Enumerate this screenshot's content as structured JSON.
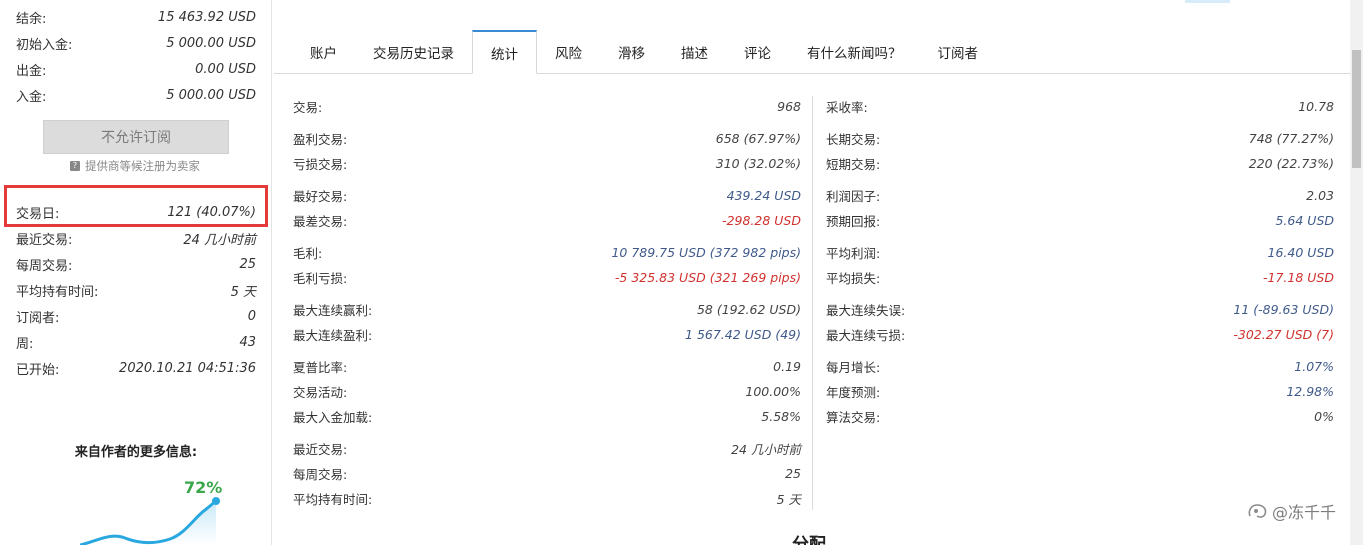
{
  "left": {
    "rows_top": [
      {
        "label": "结余:",
        "value": "15 463.92 USD"
      },
      {
        "label": "初始入金:",
        "value": "5 000.00 USD"
      },
      {
        "label": "出金:",
        "value": "0.00 USD"
      },
      {
        "label": "入金:",
        "value": "5 000.00 USD"
      }
    ],
    "subscribe_button": "不允许订阅",
    "provider_note_icon": "?",
    "provider_note": "提供商等候注册为卖家",
    "rows_bottom": [
      {
        "label": "交易日:",
        "value": "121 (40.07%)"
      },
      {
        "label": "最近交易:",
        "value": "24 几小时前"
      },
      {
        "label": "每周交易:",
        "value": "25"
      },
      {
        "label": "平均持有时间:",
        "value": "5 天"
      },
      {
        "label": "订阅者:",
        "value": "0"
      },
      {
        "label": "周:",
        "value": "43"
      },
      {
        "label": "已开始:",
        "value": "2020.10.21 04:51:36"
      }
    ],
    "more_info_title": "来自作者的更多信息:",
    "growth_percent": "72%"
  },
  "tabs": [
    {
      "label": "账户",
      "active": false
    },
    {
      "label": "交易历史记录",
      "active": false
    },
    {
      "label": "统计",
      "active": true
    },
    {
      "label": "风险",
      "active": false
    },
    {
      "label": "滑移",
      "active": false
    },
    {
      "label": "描述",
      "active": false
    },
    {
      "label": "评论",
      "active": false
    },
    {
      "label": "有什么新闻吗？",
      "active": false
    },
    {
      "label": "订阅者",
      "active": false
    }
  ],
  "stats": {
    "left": [
      {
        "label": "交易:",
        "value": "968",
        "color": "normal"
      },
      {
        "label": "盈利交易:",
        "value": "658 (67.97%)",
        "color": "normal"
      },
      {
        "label": "亏损交易:",
        "value": "310 (32.02%)",
        "color": "normal"
      },
      {
        "label": "最好交易:",
        "value": "439.24 USD",
        "color": "blue"
      },
      {
        "label": "最差交易:",
        "value": "-298.28 USD",
        "color": "red"
      },
      {
        "label": "毛利:",
        "value": "10 789.75 USD (372 982 pips)",
        "color": "blue"
      },
      {
        "label": "毛利亏损:",
        "value": "-5 325.83 USD (321 269 pips)",
        "color": "red"
      },
      {
        "label": "最大连续赢利:",
        "value": "58 (192.62 USD)",
        "color": "normal"
      },
      {
        "label": "最大连续盈利:",
        "value": "1 567.42 USD (49)",
        "color": "blue"
      },
      {
        "label": "夏普比率:",
        "value": "0.19",
        "color": "normal"
      },
      {
        "label": "交易活动:",
        "value": "100.00%",
        "color": "normal"
      },
      {
        "label": "最大入金加载:",
        "value": "5.58%",
        "color": "normal"
      },
      {
        "label": "最近交易:",
        "value": "24 几小时前",
        "color": "normal"
      },
      {
        "label": "每周交易:",
        "value": "25",
        "color": "normal"
      },
      {
        "label": "平均持有时间:",
        "value": "5 天",
        "color": "normal"
      }
    ],
    "right": [
      {
        "label": "采收率:",
        "value": "10.78",
        "color": "normal"
      },
      {
        "label": "长期交易:",
        "value": "748 (77.27%)",
        "color": "normal"
      },
      {
        "label": "短期交易:",
        "value": "220 (22.73%)",
        "color": "normal"
      },
      {
        "label": "利润因子:",
        "value": "2.03",
        "color": "normal"
      },
      {
        "label": "预期回报:",
        "value": "5.64 USD",
        "color": "blue"
      },
      {
        "label": "平均利润:",
        "value": "16.40 USD",
        "color": "blue"
      },
      {
        "label": "平均损失:",
        "value": "-17.18 USD",
        "color": "red"
      },
      {
        "label": "最大连续失误:",
        "value": "11 (-89.63 USD)",
        "color": "normal"
      },
      {
        "label": "最大连续亏损:",
        "value": "-302.27 USD (7)",
        "color": "red"
      },
      {
        "label": "每月增长:",
        "value": "1.07%",
        "color": "blue"
      },
      {
        "label": "年度预测:",
        "value": "12.98%",
        "color": "blue"
      },
      {
        "label": "算法交易:",
        "value": "0%",
        "color": "normal"
      }
    ]
  },
  "bottom_title": "分配",
  "watermark": "@冻千千",
  "colors": {
    "accent": "#3a8bd4",
    "highlight": "#e33b3b",
    "positive": "#3aa64a",
    "negative": "#d0312d",
    "blue_value": "#3f5a8a"
  }
}
